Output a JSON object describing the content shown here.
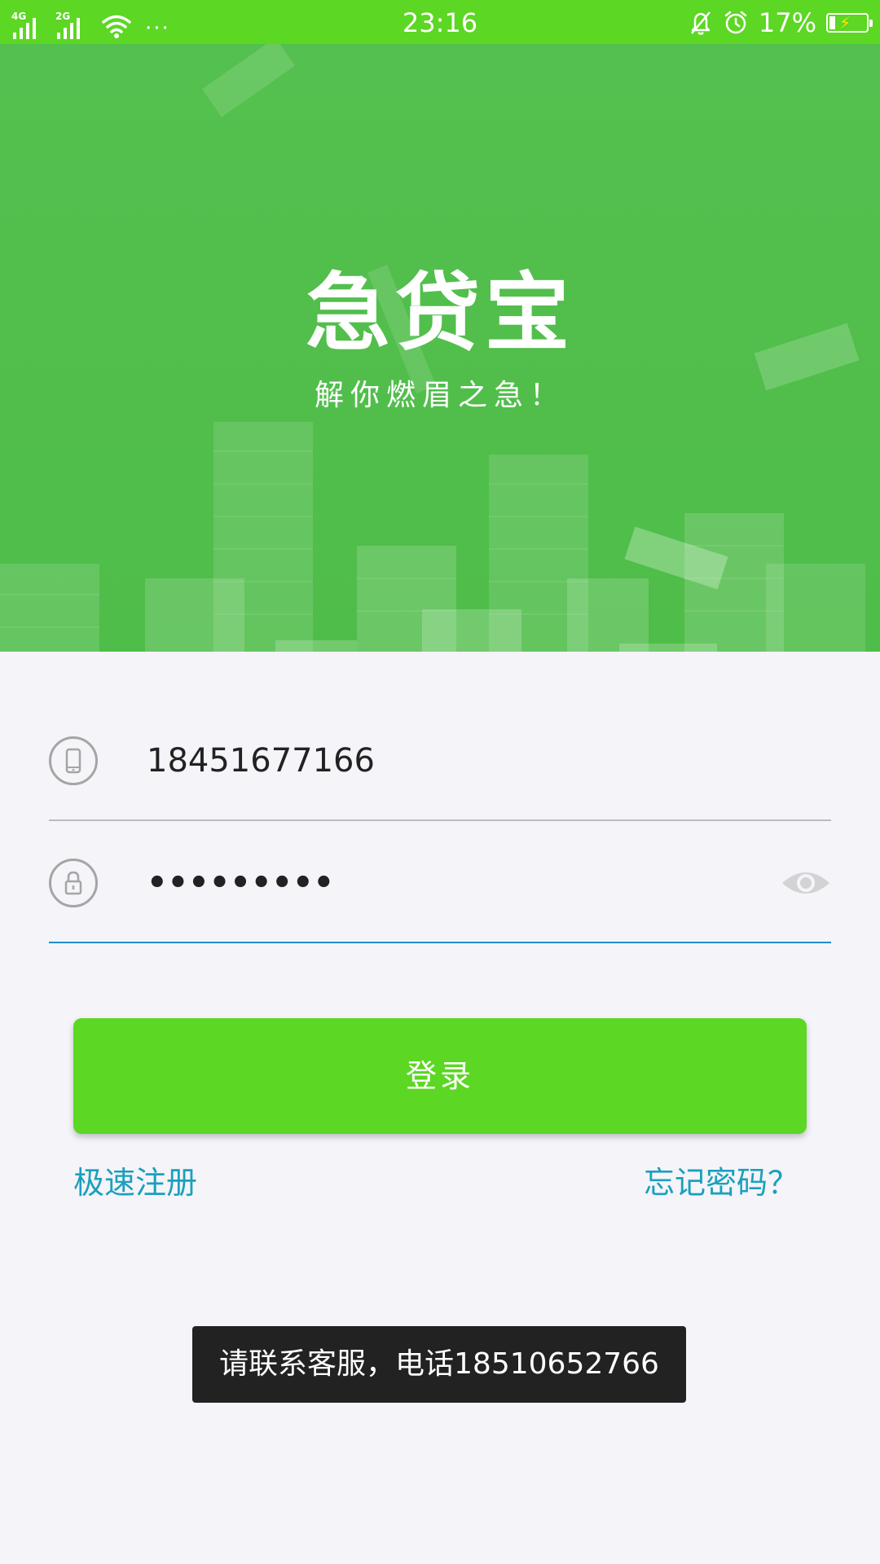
{
  "status_bar": {
    "network_1": "4G",
    "network_2": "2G",
    "more": "···",
    "time": "23:16",
    "battery_text": "17%",
    "battery_level": 0.17,
    "icons": [
      "signal-icon",
      "wifi-icon",
      "notification-muted-icon",
      "alarm-icon",
      "battery-charging-icon"
    ]
  },
  "hero": {
    "title": "急贷宝",
    "slogan": "解你燃眉之急！"
  },
  "form": {
    "phone_value": "18451677166",
    "password_value": "•••••••••",
    "login_label": "登录",
    "register_link": "极速注册",
    "forgot_link": "忘记密码？"
  },
  "toast": {
    "message": "请联系客服，电话18510652766"
  },
  "colors": {
    "brand_green": "#5cd723",
    "hero_green": "#52bf4c",
    "link_blue": "#1aa0bd",
    "focus_blue": "#1e8fcf",
    "background": "#f4f4f9",
    "toast_bg": "#222222"
  }
}
